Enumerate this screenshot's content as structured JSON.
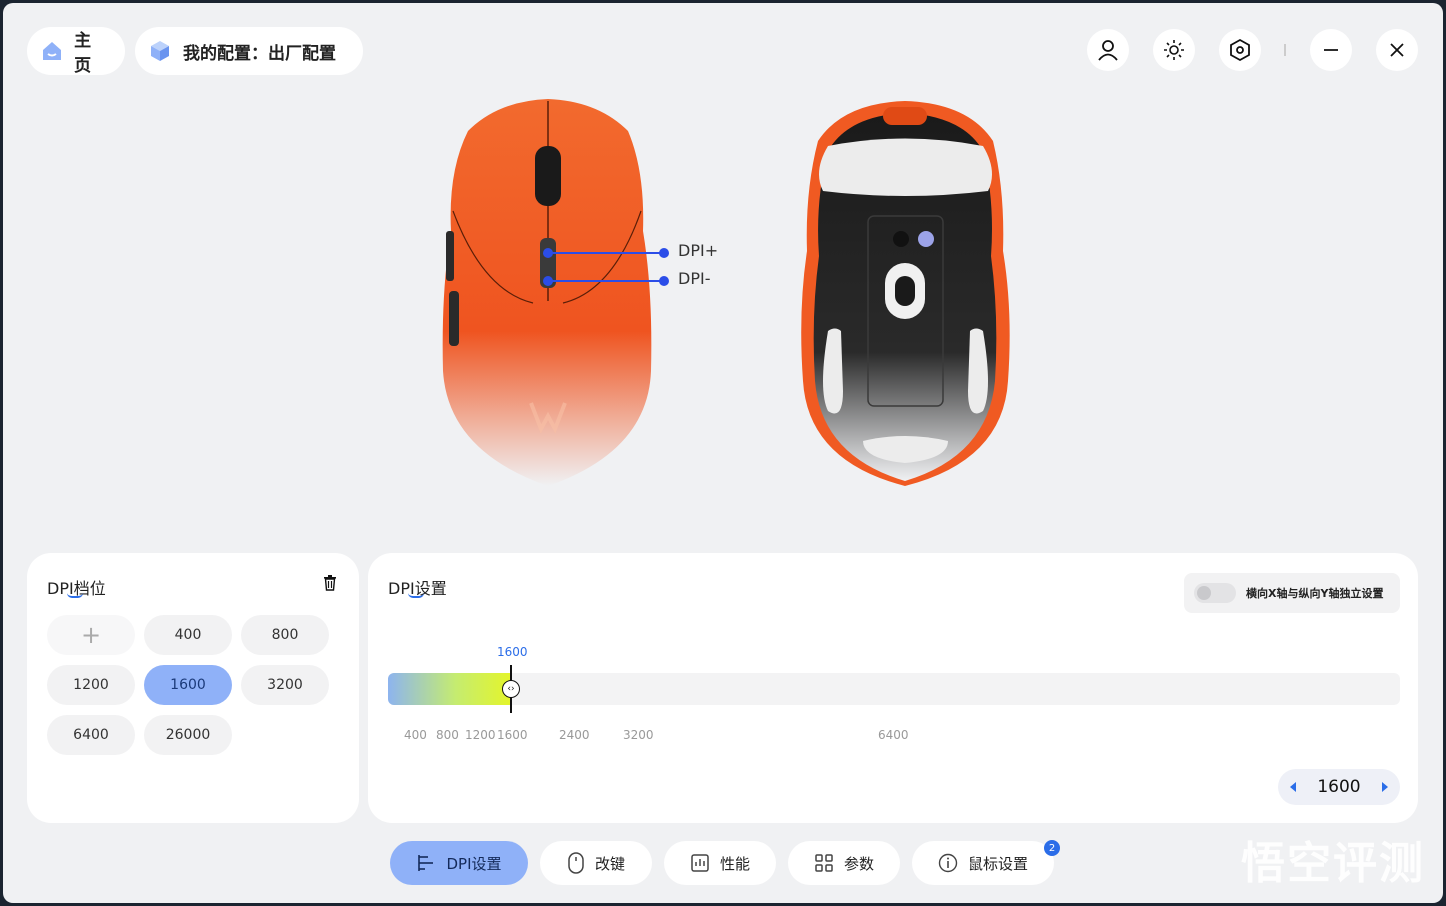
{
  "header": {
    "home_label": "主页",
    "config_label": "我的配置：出厂配置",
    "icons": [
      "user-icon",
      "brightness-icon",
      "settings-hex-icon",
      "minimize-icon",
      "close-icon"
    ]
  },
  "mouse": {
    "dpi_plus_label": "DPI+",
    "dpi_minus_label": "DPI-",
    "color": "#f05a22"
  },
  "dpi_levels": {
    "title": "DPI档位",
    "add_symbol": "+",
    "chips": [
      "400",
      "800",
      "1200",
      "1600",
      "3200",
      "6400",
      "26000"
    ],
    "active": "1600"
  },
  "dpi_settings": {
    "title": "DPI设置",
    "toggle_label": "横向X轴与纵向Y轴独立设置",
    "toggle_on": false,
    "slider_value_label": "1600",
    "slider_value": 1600,
    "slider_max": 26000,
    "ticks": [
      "400",
      "800",
      "1200",
      "1600",
      "2400",
      "3200",
      "6400"
    ],
    "stepper_value": "1600"
  },
  "tabs": [
    {
      "label": "DPI设置",
      "icon": "dpi-icon",
      "active": true
    },
    {
      "label": "改键",
      "icon": "mouse-icon",
      "active": false
    },
    {
      "label": "性能",
      "icon": "performance-icon",
      "active": false
    },
    {
      "label": "参数",
      "icon": "grid-icon",
      "active": false
    },
    {
      "label": "鼠标设置",
      "icon": "info-icon",
      "active": false
    }
  ],
  "badge_count": "2",
  "watermark": "悟空评测",
  "colors": {
    "accent": "#2b6de8",
    "active_chip": "#8fb1f8"
  }
}
